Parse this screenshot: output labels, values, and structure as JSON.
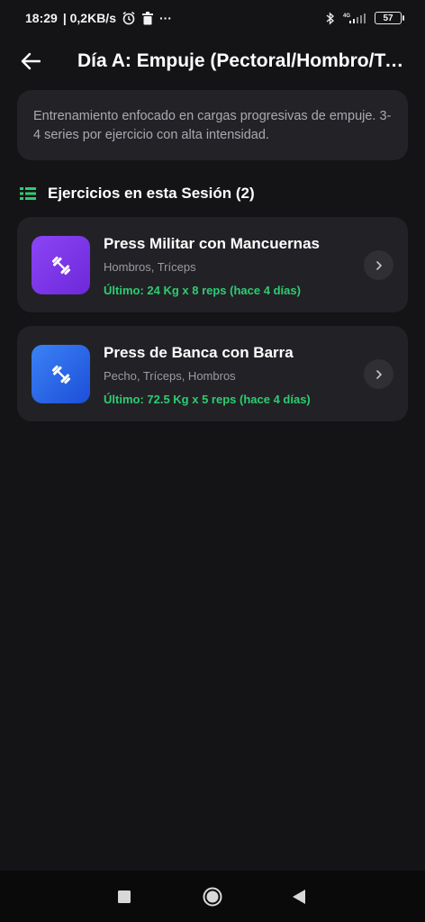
{
  "status_bar": {
    "time": "18:29",
    "network_speed": "| 0,2KB/s",
    "more": "···",
    "network_type": "4G",
    "battery": "57"
  },
  "header": {
    "title": "Día A: Empuje (Pectoral/Hombro/Tr…"
  },
  "description": "Entrenamiento enfocado en cargas progresivas de empuje. 3-4 series por ejercicio con alta intensidad.",
  "section": {
    "title": "Ejercicios en esta Sesión (2)"
  },
  "exercises": [
    {
      "name": "Press Militar con Mancuernas",
      "muscles": "Hombros, Tríceps",
      "last": "Último: 24 Kg x 8 reps (hace 4 días)",
      "icon": "dumbbell-icon"
    },
    {
      "name": "Press de Banca con Barra",
      "muscles": "Pecho, Tríceps, Hombros",
      "last": "Último: 72.5 Kg x 5 reps (hace 4 días)",
      "icon": "dumbbell-icon"
    }
  ],
  "colors": {
    "background": "#141416",
    "card": "#222226",
    "accent_green": "#2ecc71",
    "thumb_purple": "#7c3aed",
    "thumb_blue": "#2563eb"
  }
}
